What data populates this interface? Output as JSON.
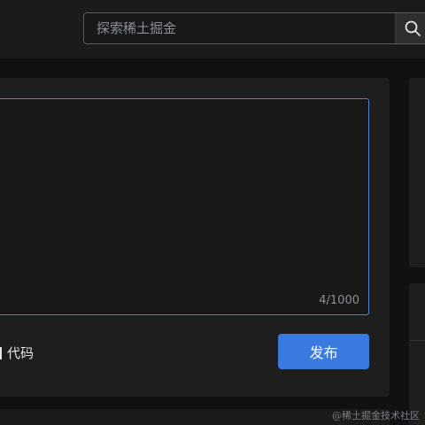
{
  "search": {
    "placeholder": "探索稀土掘金",
    "button_icon": "search-icon"
  },
  "editor": {
    "counter": "4/1000"
  },
  "toolbar": {
    "code_label": "代码",
    "publish_label": "发布"
  },
  "watermark": "@稀土掘金技术社区",
  "colors": {
    "accent": "#3b7be0",
    "editor_border": "#4b82e0"
  }
}
